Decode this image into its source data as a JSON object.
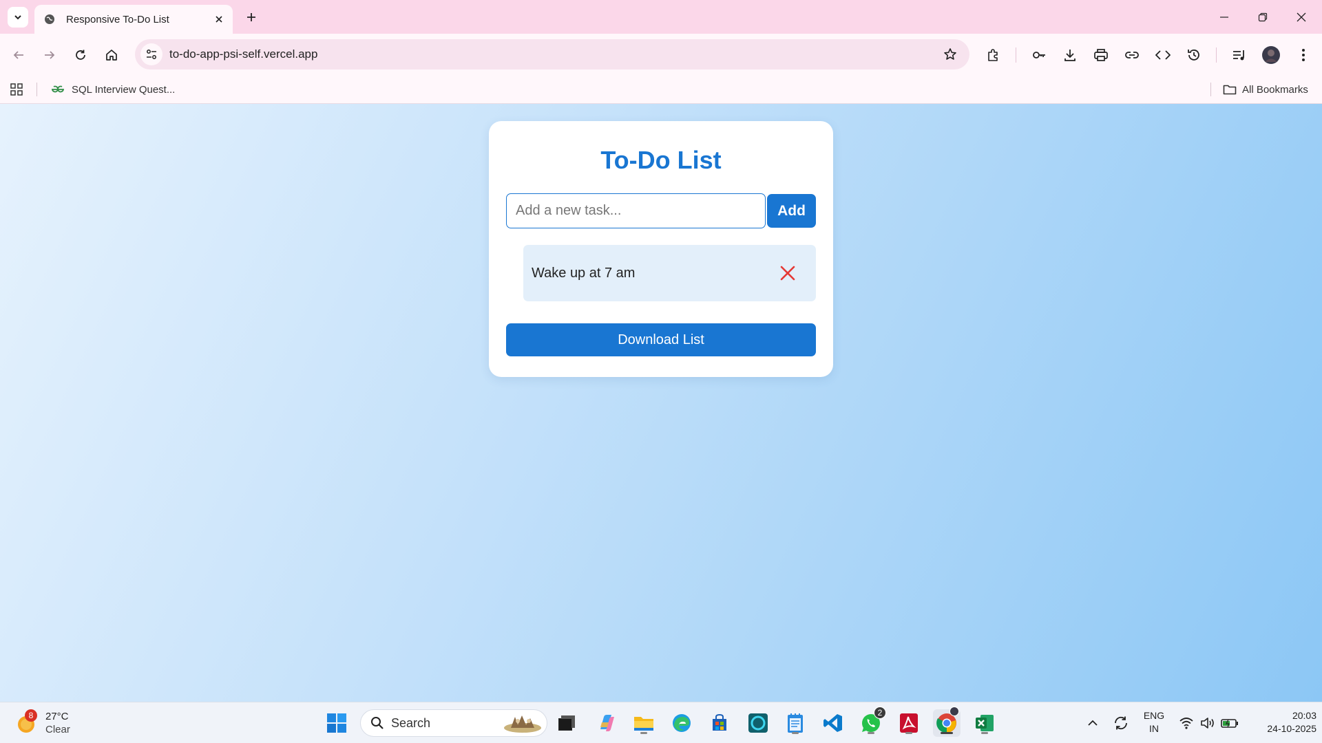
{
  "browser": {
    "tab_title": "Responsive To-Do List",
    "url": "to-do-app-psi-self.vercel.app",
    "bookmarks": [
      {
        "label": "SQL Interview Quest..."
      }
    ],
    "all_bookmarks_label": "All Bookmarks"
  },
  "app": {
    "title": "To-Do List",
    "input": {
      "value": "",
      "placeholder": "Add a new task..."
    },
    "add_label": "Add",
    "tasks": [
      {
        "text": "Wake up at 7 am"
      }
    ],
    "download_label": "Download List",
    "colors": {
      "accent": "#1976d2",
      "delete": "#e53935",
      "task_bg": "#e3effa"
    }
  },
  "taskbar": {
    "weather": {
      "temp": "27°C",
      "condition": "Clear",
      "badge": "8"
    },
    "search_label": "Search",
    "whatsapp_badge": "2",
    "lang": {
      "line1": "ENG",
      "line2": "IN"
    },
    "clock": {
      "time": "20:03",
      "date": "24-10-2025"
    }
  }
}
